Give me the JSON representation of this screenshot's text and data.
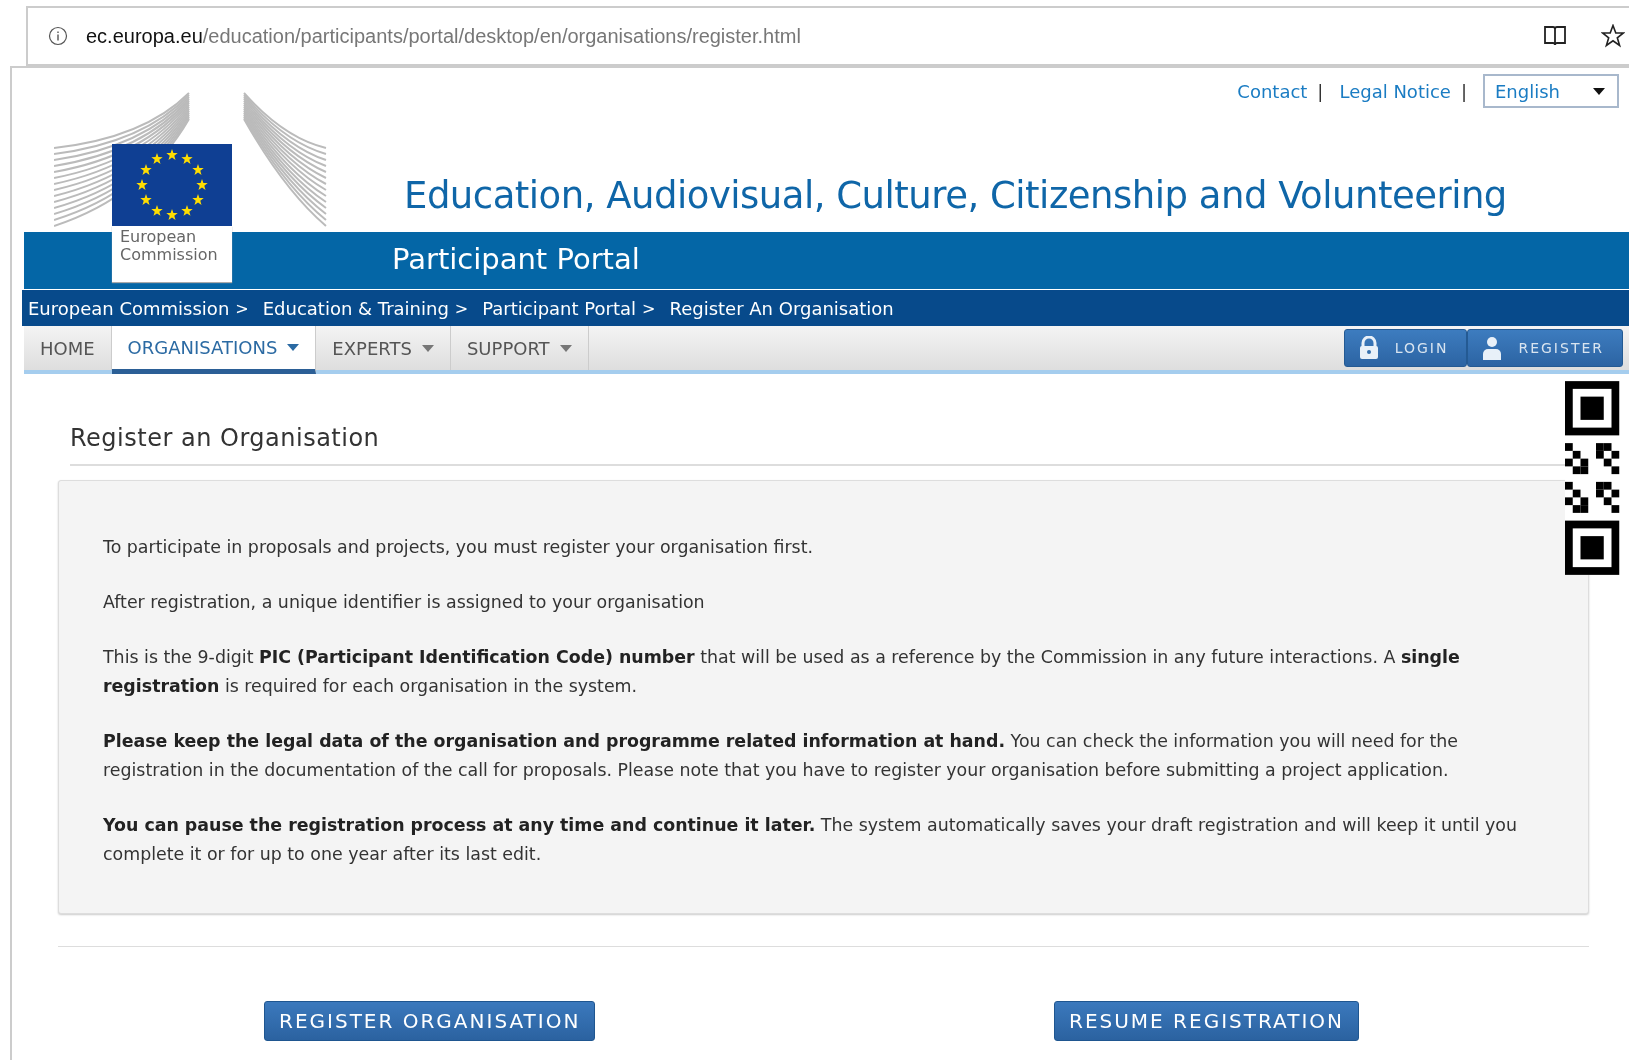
{
  "address_bar": {
    "domain": "ec.europa.eu",
    "path": "/education/participants/portal/desktop/en/organisations/register.html"
  },
  "top_links": [
    {
      "label": "Contact",
      "separator": "|"
    },
    {
      "label": "Legal Notice",
      "separator": "|"
    }
  ],
  "language_select": {
    "value": "English"
  },
  "logo": {
    "text": "European Commission"
  },
  "header": {
    "title": "Education, Audiovisual, Culture, Citizenship and Volunteering",
    "subtitle": "Participant Portal"
  },
  "breadcrumbs": [
    {
      "label": "European Commission",
      "separator": ">"
    },
    {
      "label": "Education & Training",
      "separator": ">"
    },
    {
      "label": "Participant Portal",
      "separator": ">"
    },
    {
      "label": "Register An Organisation"
    }
  ],
  "nav_tabs": [
    {
      "label": "HOME",
      "dropdown": false,
      "selected": false
    },
    {
      "label": "ORGANISATIONS",
      "dropdown": true,
      "selected": true
    },
    {
      "label": "EXPERTS",
      "dropdown": true,
      "selected": false
    },
    {
      "label": "SUPPORT",
      "dropdown": true,
      "selected": false
    }
  ],
  "account_buttons": [
    {
      "kind": "login",
      "label": "LOGIN"
    },
    {
      "kind": "register",
      "label": "REGISTER"
    }
  ],
  "page_title": "Register an Organisation",
  "paragraphs": [
    "To participate in proposals and projects, you must register your organisation first.",
    "After registration, a unique identifier is assigned to your organisation",
    "This is the 9-digit **PIC (Participant Identification Code) number** that will be used as a reference by the Commission in any future interactions. A **single registration** is required for each organisation in the system.",
    "**Please keep the legal data of the organisation and programme related information at hand.** You can check the information you will need for the registration in the documentation of the call for proposals. Please note that you have to register your organisation before submitting a project application.",
    "**You can pause the registration process at any time and continue it later.** The system automatically saves your draft registration and will keep it until you complete it or for up to one year after its last edit."
  ],
  "action_buttons": [
    "REGISTER ORGANISATION",
    "RESUME REGISTRATION"
  ]
}
